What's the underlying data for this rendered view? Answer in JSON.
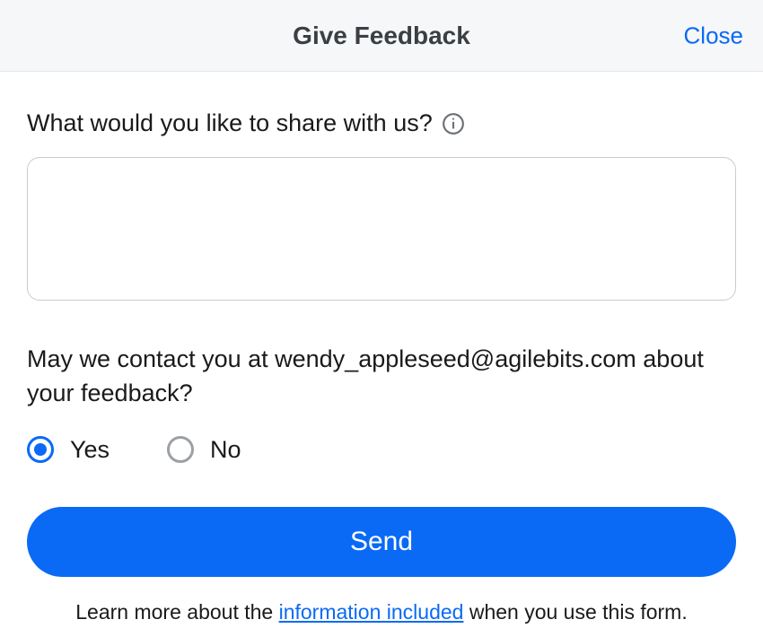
{
  "header": {
    "title": "Give Feedback",
    "close": "Close"
  },
  "form": {
    "share_label": "What would you like to share with us?",
    "contact_question": "May we contact you at wendy_appleseed@agilebits.com about your feedback?",
    "radio_yes": "Yes",
    "radio_no": "No",
    "send_button": "Send"
  },
  "footer": {
    "learn_prefix": "Learn more about the ",
    "learn_link": "information included",
    "learn_suffix": " when you use this form."
  }
}
